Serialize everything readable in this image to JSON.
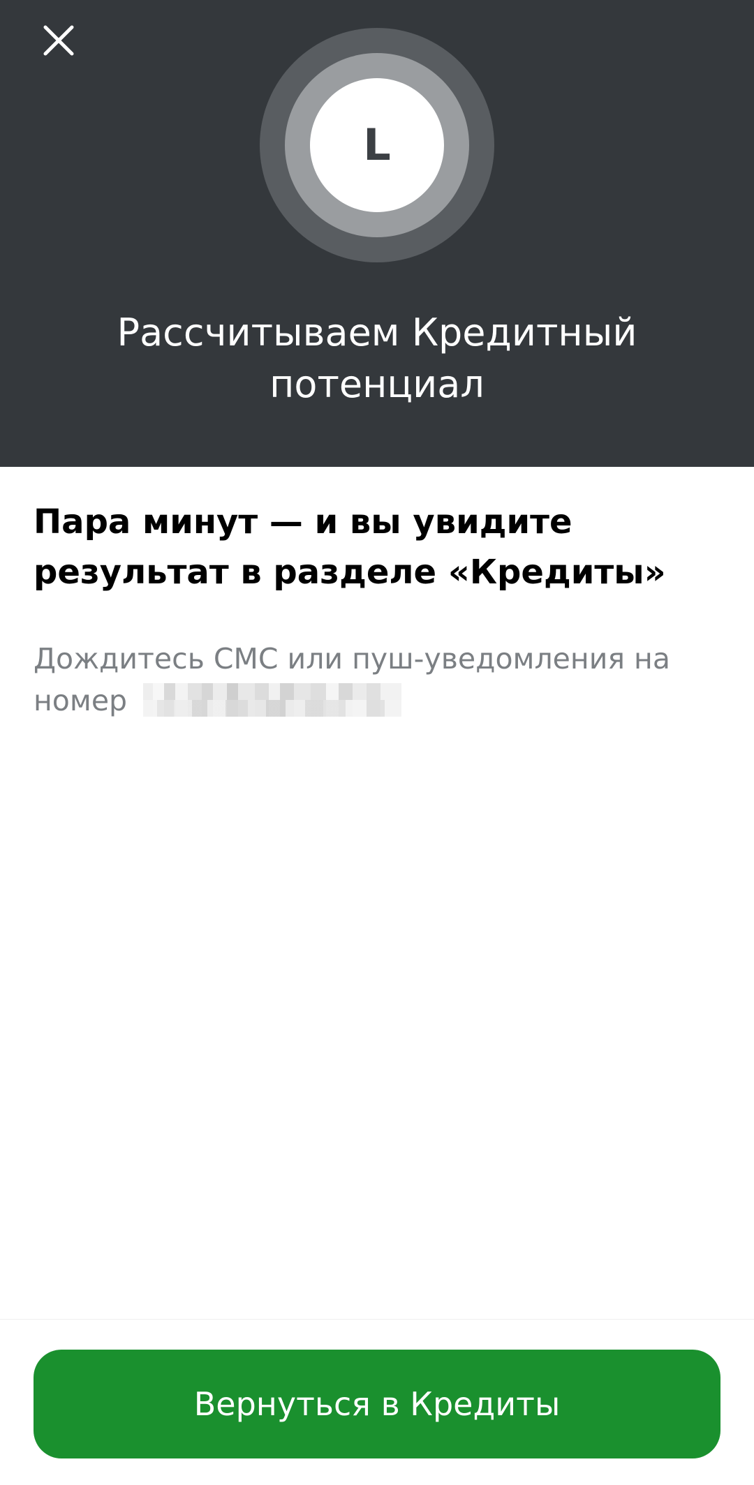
{
  "header": {
    "close_icon": "close-icon",
    "avatar_letter": "L",
    "title": "Рассчитываем Кредитный потенциал"
  },
  "content": {
    "heading": "Пара минут — и вы увидите результат в разделе «Кредиты»",
    "description": "Дождитесь СМС или пуш-уведомления на номер"
  },
  "footer": {
    "button_label": "Вернуться в Кредиты"
  },
  "colors": {
    "header_bg": "#34383c",
    "accent_green": "#1a902e",
    "text_secondary": "#7b7f83"
  }
}
